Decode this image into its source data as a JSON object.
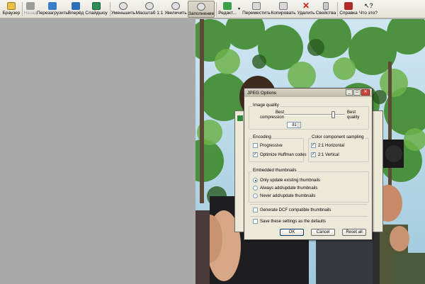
{
  "toolbar": {
    "browser": "Браузер",
    "back": "Назад",
    "reload": "Перезагрузить",
    "forward": "Вперёд",
    "slideshow": "Слайдшоу",
    "zoom_out": "Уменьшить",
    "scale": "Масштаб 1:1",
    "zoom_in": "Увеличить",
    "fill": "Заполнение",
    "edit": "Редакт...",
    "move": "Переместить",
    "copy": "Копировать",
    "delete": "Удалить",
    "properties": "Свойства",
    "help": "Справка",
    "whats_this": "Что это?"
  },
  "dialog": {
    "title": "JPEG Options",
    "image_quality": "Image quality",
    "best_compression": "Best compression",
    "best_quality": "Best quality",
    "quality_value": "81",
    "quality_level": 0.81,
    "encoding": "Encoding",
    "progressive": "Progressive",
    "optimize_huffman": "Optimize Huffman codes",
    "color_sampling": "Color component sampling",
    "h_2_1": "2:1 Horizontal",
    "v_2_1": "2:1 Vertical",
    "thumbnails": "Embedded thumbnails",
    "only_update": "Only update existing thumbnails",
    "always_add": "Always add/update thumbnails",
    "never_add": "Never add/update thumbnails",
    "dcf": "Generate DCF compatible thumbnails",
    "save_defaults": "Save these settings as the defaults",
    "ok": "OK",
    "cancel": "Cancel",
    "reset": "Reset all"
  },
  "colors": {
    "accent_close": "#c8463a",
    "dialog_bg": "#ece9d8"
  }
}
